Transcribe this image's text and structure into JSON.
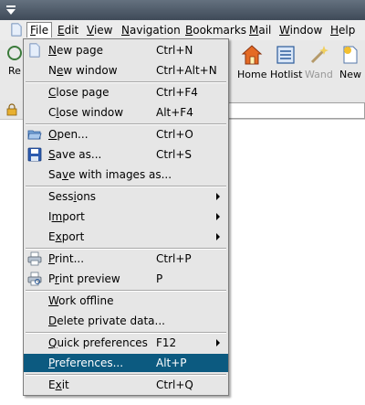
{
  "menubar": {
    "items": [
      {
        "label": "File",
        "mnemonic_index": 0
      },
      {
        "label": "Edit",
        "mnemonic_index": 0
      },
      {
        "label": "View",
        "mnemonic_index": 0
      },
      {
        "label": "Navigation",
        "mnemonic_index": 0
      },
      {
        "label": "Bookmarks",
        "mnemonic_index": 0
      },
      {
        "label": "Mail",
        "mnemonic_index": 0
      },
      {
        "label": "Window",
        "mnemonic_index": 0
      },
      {
        "label": "Help",
        "mnemonic_index": 0
      }
    ],
    "active": "File"
  },
  "toolbar": {
    "left_partial_label": "Re",
    "buttons": [
      {
        "label": "Home",
        "icon": "home-icon",
        "enabled": true
      },
      {
        "label": "Hotlist",
        "icon": "hotlist-icon",
        "enabled": true
      },
      {
        "label": "Wand",
        "icon": "wand-icon",
        "enabled": false
      },
      {
        "label": "New",
        "icon": "new-page-icon",
        "enabled": true
      }
    ]
  },
  "file_menu": {
    "rows": [
      {
        "label": "New page",
        "mnemonic_index": 0,
        "shortcut": "Ctrl+N",
        "icon": "new-page-icon"
      },
      {
        "label": "New window",
        "mnemonic_index": 1,
        "shortcut": "Ctrl+Alt+N"
      },
      {
        "label": "Close page",
        "mnemonic_index": 0,
        "shortcut": "Ctrl+F4"
      },
      {
        "label": "Close window",
        "mnemonic_index": 1,
        "shortcut": "Alt+F4"
      },
      {
        "label": "Open...",
        "mnemonic_index": 0,
        "shortcut": "Ctrl+O",
        "icon": "open-folder-icon"
      },
      {
        "label": "Save as...",
        "mnemonic_index": 0,
        "shortcut": "Ctrl+S",
        "icon": "save-icon"
      },
      {
        "label": "Save with images as...",
        "mnemonic_index": 2,
        "shortcut": ""
      },
      {
        "label": "Sessions",
        "mnemonic_index": 4,
        "shortcut": "",
        "submenu": true
      },
      {
        "label": "Import",
        "mnemonic_index": 1,
        "shortcut": "",
        "submenu": true
      },
      {
        "label": "Export",
        "mnemonic_index": 1,
        "shortcut": "",
        "submenu": true
      },
      {
        "label": "Print...",
        "mnemonic_index": 0,
        "shortcut": "Ctrl+P",
        "icon": "printer-icon"
      },
      {
        "label": "Print preview",
        "mnemonic_index": 1,
        "shortcut": "P",
        "icon": "print-preview-icon"
      },
      {
        "label": "Work offline",
        "mnemonic_index": 0,
        "shortcut": ""
      },
      {
        "label": "Delete private data...",
        "mnemonic_index": 0,
        "shortcut": ""
      },
      {
        "label": "Quick preferences",
        "mnemonic_index": 0,
        "shortcut": "F12",
        "submenu": true
      },
      {
        "label": "Preferences...",
        "mnemonic_index": 0,
        "shortcut": "Alt+P",
        "highlighted": true
      },
      {
        "label": "Exit",
        "mnemonic_index": 1,
        "shortcut": "Ctrl+Q"
      }
    ]
  },
  "colors": {
    "highlight": "#0c5a80",
    "menu_background": "#e6e6e6"
  }
}
